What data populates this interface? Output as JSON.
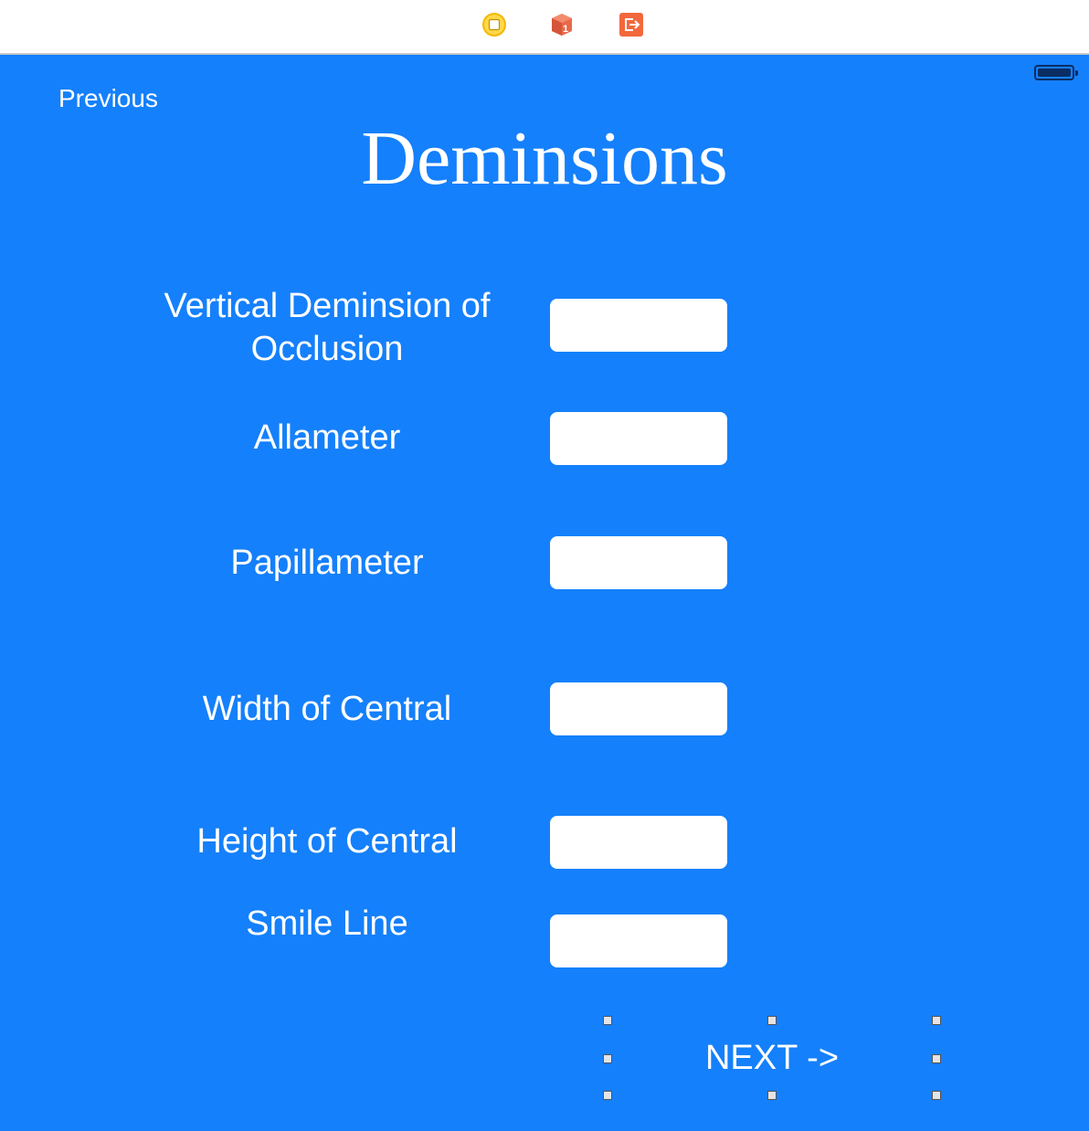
{
  "dock": {
    "icons": [
      "view-controller-icon",
      "first-responder-icon",
      "exit-icon"
    ],
    "first_responder_badge": "1"
  },
  "status_bar": {
    "battery": "battery-icon"
  },
  "nav": {
    "previous_label": "Previous"
  },
  "title": "Deminsions",
  "fields": [
    {
      "label": "Vertical Deminsion of Occlusion",
      "value": "",
      "placeholder": ""
    },
    {
      "label": "Allameter",
      "value": "",
      "placeholder": ""
    },
    {
      "label": "Papillameter",
      "value": "",
      "placeholder": ""
    },
    {
      "label": "Width of Central",
      "value": "",
      "placeholder": ""
    },
    {
      "label": "Height of Central",
      "value": "",
      "placeholder": ""
    },
    {
      "label": "Smile Line",
      "value": "",
      "placeholder": ""
    }
  ],
  "next_button": {
    "label": "NEXT ->"
  },
  "colors": {
    "background": "#1580fb",
    "text": "#ffffff",
    "field_background": "#ffffff",
    "view_controller_icon": "#f5b800",
    "first_responder_icon": "#e8694a",
    "exit_icon": "#f2683d"
  }
}
